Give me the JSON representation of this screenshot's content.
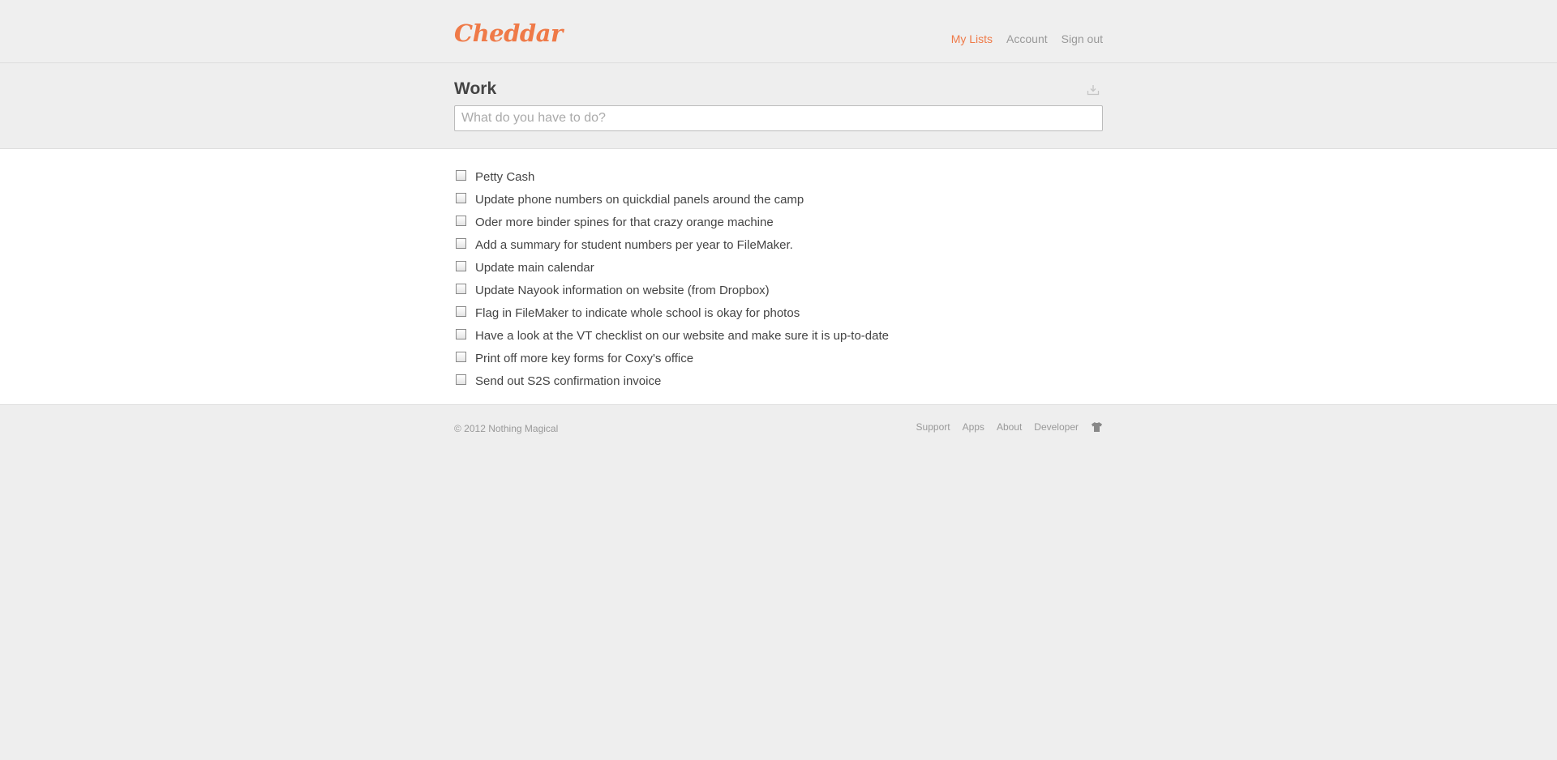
{
  "brand": {
    "name": "Cheddar",
    "color": "#ef7a48"
  },
  "nav": {
    "items": [
      {
        "label": "My Lists",
        "active": true
      },
      {
        "label": "Account",
        "active": false
      },
      {
        "label": "Sign out",
        "active": false
      }
    ]
  },
  "list": {
    "title": "Work",
    "archive_icon": "archive-download-icon",
    "input_placeholder": "What do you have to do?",
    "input_value": ""
  },
  "tasks": [
    {
      "text": "Petty Cash",
      "completed": false
    },
    {
      "text": "Update phone numbers on quickdial panels around the camp",
      "completed": false
    },
    {
      "text": "Oder more binder spines for that crazy orange machine",
      "completed": false
    },
    {
      "text": "Add a summary for student numbers per year to FileMaker.",
      "completed": false
    },
    {
      "text": "Update main calendar",
      "completed": false
    },
    {
      "text": "Update Nayook information on website (from Dropbox)",
      "completed": false
    },
    {
      "text": "Flag in FileMaker to indicate whole school is okay for photos",
      "completed": false
    },
    {
      "text": "Have a look at the VT checklist on our website and make sure it is up-to-date",
      "completed": false
    },
    {
      "text": "Print off more key forms for Coxy's office",
      "completed": false
    },
    {
      "text": "Send out S2S confirmation invoice",
      "completed": false
    }
  ],
  "footer": {
    "copyright": "© 2012 Nothing Magical",
    "links": [
      "Support",
      "Apps",
      "About",
      "Developer"
    ],
    "shirt_icon": "tshirt-icon"
  }
}
